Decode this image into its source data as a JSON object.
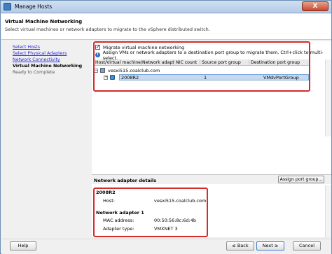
{
  "window": {
    "title": "Manage Hosts",
    "close_glyph": "X"
  },
  "header": {
    "title": "Virtual Machine Networking",
    "subtitle": "Select virtual machines or network adapters to migrate to the vSphere distributed switch."
  },
  "steps": [
    {
      "label": "Select Hosts",
      "state": "link"
    },
    {
      "label": "Select Physical Adapters",
      "state": "link"
    },
    {
      "label": "Network Connectivity",
      "state": "link"
    },
    {
      "label": "Virtual Machine Networking",
      "state": "current"
    },
    {
      "label": "Ready to Complete",
      "state": "todo"
    }
  ],
  "migrate": {
    "checkbox_label": "Migrate virtual machine networking",
    "checked": true,
    "info_text": "Assign VMs or network adapters to a destination port group to migrate them. Ctrl+click to multi-select."
  },
  "grid": {
    "columns": [
      "Host/Virtual machine/Network adapter",
      "NIC count",
      "Source port group",
      "Destination port group"
    ],
    "host": {
      "name": "vesxi515.coalclub.com",
      "expander": "−"
    },
    "vm": {
      "expander": "+",
      "name": "2008R2",
      "nic_count": "1",
      "source": "",
      "destination": "VMdvPortGroup"
    }
  },
  "details": {
    "section_title": "Network adapter details",
    "assign_button": "Assign port group...",
    "vm_name": "2008R2",
    "host_label": "Host:",
    "host_value": "vesxi515.coalclub.com",
    "adapter_title": "Network adapter 1",
    "mac_label": "MAC address:",
    "mac_value": "00:50:56:8c:6d:4b",
    "type_label": "Adapter type:",
    "type_value": "VMXNET 3"
  },
  "footer": {
    "help": "Help",
    "back": "≤ Back",
    "next": "Next ≥",
    "cancel": "Cancel"
  },
  "colors": {
    "highlight_box": "#d42b2b",
    "link": "#2a2ad8",
    "selection": "#c5daf2"
  }
}
